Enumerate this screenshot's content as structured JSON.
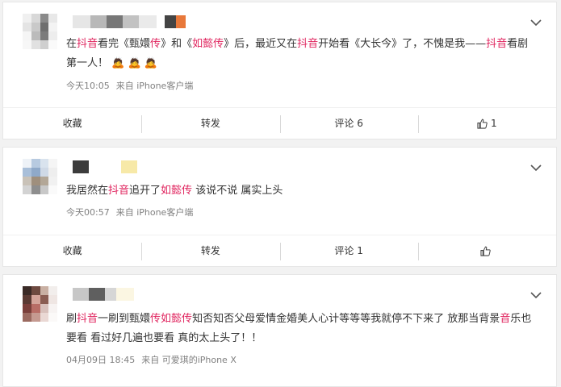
{
  "posts": [
    {
      "content": [
        {
          "t": "在",
          "hl": false
        },
        {
          "t": "抖音",
          "hl": true
        },
        {
          "t": "看完《甄嬛",
          "hl": false
        },
        {
          "t": "传",
          "hl": true
        },
        {
          "t": "》和《",
          "hl": false
        },
        {
          "t": "如懿传",
          "hl": true
        },
        {
          "t": "》后，最近又在",
          "hl": false
        },
        {
          "t": "抖音",
          "hl": true
        },
        {
          "t": "开始看《大长今》了，不愧是我——",
          "hl": false
        },
        {
          "t": "抖音",
          "hl": true
        },
        {
          "t": "看剧第一人！ 🙇 🙇 🙇",
          "hl": false
        }
      ],
      "time": "今天10:05",
      "source": "来自 iPhone客户端",
      "actions": {
        "collect": "收藏",
        "repost": "转发",
        "comment": "评论 6",
        "like_count": "1"
      }
    },
    {
      "content": [
        {
          "t": "我居然在",
          "hl": false
        },
        {
          "t": "抖音",
          "hl": true
        },
        {
          "t": "追开了",
          "hl": false
        },
        {
          "t": "如懿传",
          "hl": true
        },
        {
          "t": " 该说不说 属实上头",
          "hl": false
        }
      ],
      "time": "今天00:57",
      "source": "来自 iPhone客户端",
      "actions": {
        "collect": "收藏",
        "repost": "转发",
        "comment": "评论 1",
        "like_count": ""
      }
    },
    {
      "content": [
        {
          "t": "刷",
          "hl": false
        },
        {
          "t": "抖音",
          "hl": true
        },
        {
          "t": "一刷到甄嬛",
          "hl": false
        },
        {
          "t": "传如懿传",
          "hl": true
        },
        {
          "t": "知否知否父母爱情金婚美人心计等等等我就停不下来了 放那当背景",
          "hl": false
        },
        {
          "t": "音",
          "hl": true
        },
        {
          "t": "乐也要看 看过好几遍也要看 真的太上头了！！",
          "hl": false
        }
      ],
      "time": "04月09日 18:45",
      "source": "来自 可爱琪的iPhone X",
      "actions": null
    }
  ]
}
